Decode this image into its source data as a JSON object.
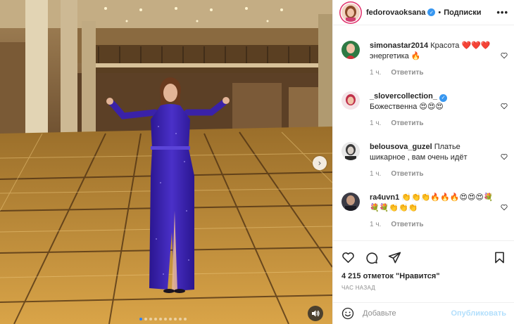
{
  "post": {
    "author": "fedorovaoksana",
    "separator": "•",
    "follow_label": "Подписки",
    "more_label": "•••",
    "likes_text": "4 215 отметок \"Нравится\"",
    "time_text": "ЧАС НАЗАД"
  },
  "media": {
    "next_icon": "chevron-right-icon",
    "sound_icon": "speaker-icon",
    "carousel_total": 10,
    "carousel_active": 1
  },
  "comments": [
    {
      "user": "simonastar2014",
      "verified": false,
      "text": "Красота ❤️❤️❤️ энергетика 🔥",
      "age": "1 ч.",
      "reply": "Ответить"
    },
    {
      "user": "_slovercollection_",
      "verified": true,
      "text": "Божественна 😍😍😍",
      "age": "1 ч.",
      "reply": "Ответить"
    },
    {
      "user": "belousova_guzel",
      "verified": false,
      "text": "Платье шикарное , вам очень идёт",
      "age": "1 ч.",
      "reply": "Ответить"
    },
    {
      "user": "ra4uvn1",
      "verified": false,
      "text": "👏👏👏🔥🔥🔥😍😍😍💐💐💐👏👏👏",
      "age": "1 ч.",
      "reply": "Ответить"
    }
  ],
  "add_comment": {
    "placeholder": "Добавьте",
    "publish_label": "Опубликовать"
  },
  "colors": {
    "verified": "#3897f0",
    "publish_disabled": "#b2dffc",
    "story_ring": "#e1306c",
    "dress": "#3a22a8",
    "floor": "#c8963c"
  }
}
